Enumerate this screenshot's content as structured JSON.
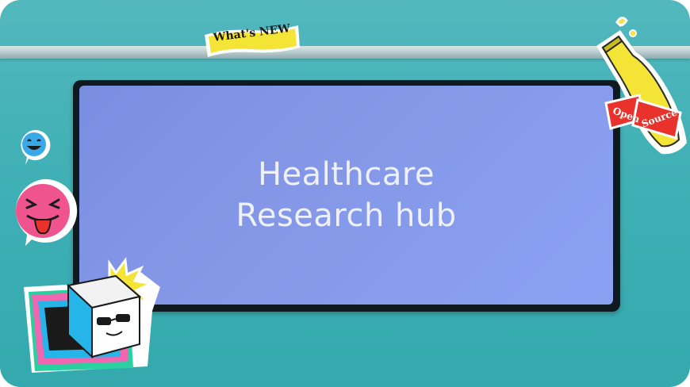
{
  "hero": {
    "title_line_1": "Healthcare",
    "title_line_2": "Research hub"
  },
  "stickers": {
    "whats_new": "What's NEW",
    "open_source_left": "Open",
    "open_source_right": "Source"
  },
  "icons": [
    "smiley-icon",
    "tongue-face-icon",
    "cool-cube-icon",
    "bottle-icon"
  ],
  "colors": {
    "background_teal": "#41b1b6",
    "screen_periwinkle": "#8598e8",
    "headline_text": "#eef0fb",
    "sticker_yellow": "#f3e436",
    "label_red": "#e8322b"
  }
}
